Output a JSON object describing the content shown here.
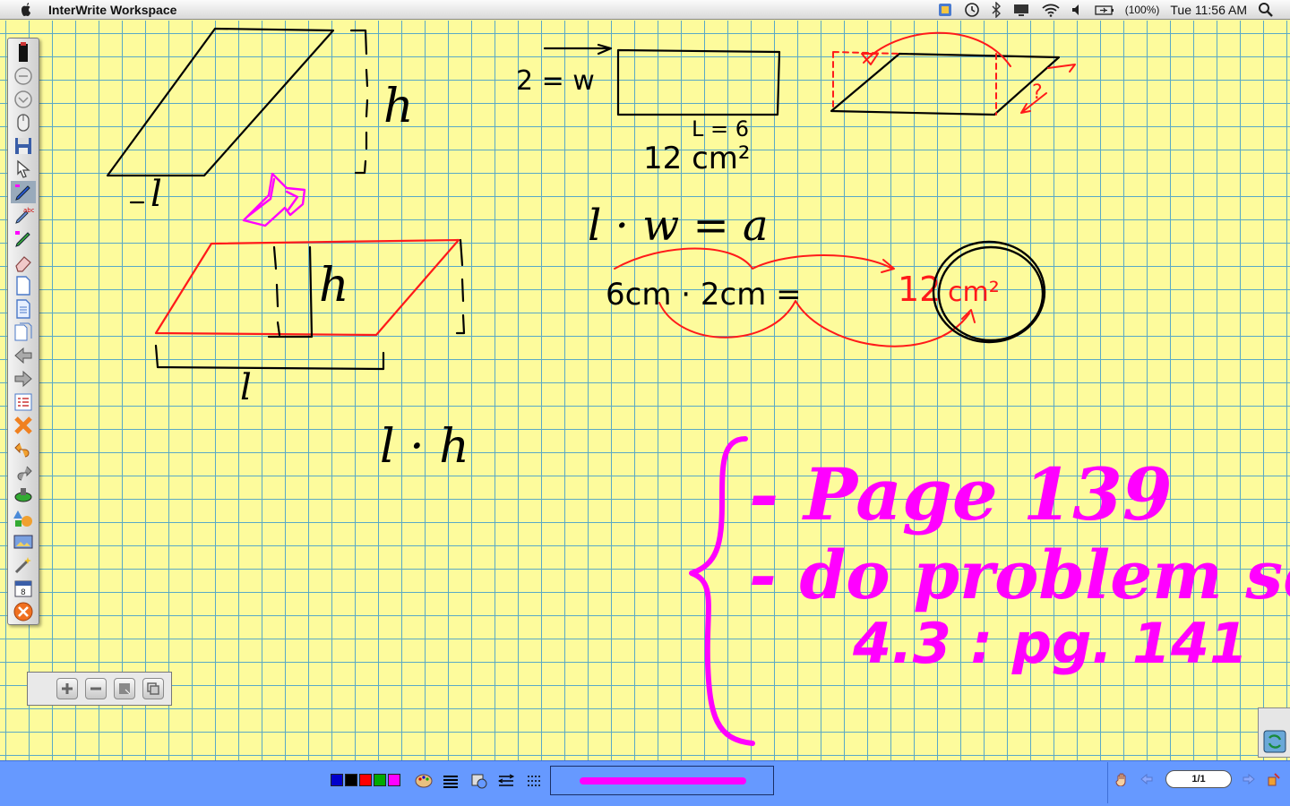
{
  "menubar": {
    "app_title": "InterWrite Workspace",
    "battery_percent": "(100%)",
    "clock": "Tue 11:56 AM",
    "status_icons": [
      "app-status-icon",
      "time-machine-icon",
      "bluetooth-icon",
      "display-icon",
      "wifi-icon",
      "volume-icon",
      "battery-icon",
      "spotlight-icon"
    ]
  },
  "whiteboard": {
    "annotations": {
      "h_top": "h",
      "l_top": "l",
      "h_mid": "h",
      "l_mid": "l",
      "l_times_h": "l · h",
      "w_eq": "2 = w",
      "L_eq": "L = 6",
      "area_rect": "12 cm²",
      "formula": "l · w = a",
      "calc_left": "6cm · 2cm =",
      "calc_result_num": "12",
      "calc_result_unit": "cm²",
      "question_mark": "?",
      "hw_line1": "- Page 139",
      "hw_line2": "- do problem set",
      "hw_line3": "4.3 : pg. 141"
    },
    "colors": {
      "black_ink": "#000000",
      "red_ink": "#ff1a1a",
      "magenta_ink": "#ff00ff",
      "grid": "#5aa9c6",
      "paper": "#fdfb9c"
    }
  },
  "toolbar": {
    "tools": [
      "pen-holder-icon",
      "circle-icon",
      "circle-outline-icon",
      "mouse-icon",
      "save-icon",
      "select-arrow-icon",
      "pen-icon",
      "text-pen-icon",
      "highlighter-icon",
      "eraser-icon",
      "new-page-icon",
      "page-icon",
      "pages-icon",
      "previous-page-icon",
      "next-page-icon",
      "page-sorter-icon",
      "clear-icon",
      "undo-icon",
      "redo-icon",
      "spotlight-tool-icon",
      "shapes-icon",
      "image-icon",
      "magic-wand-icon",
      "calendar-icon",
      "close-icon"
    ]
  },
  "zoom_palette": {
    "buttons": [
      "zoom-in-icon",
      "zoom-out-icon",
      "note-icon",
      "copy-icon"
    ]
  },
  "bottombar": {
    "swatches": [
      "#0000cc",
      "#000000",
      "#ff0000",
      "#00aa00",
      "#ff00ff"
    ],
    "pen_preview_color": "#ff00ff",
    "page_indicator": "1/1"
  }
}
